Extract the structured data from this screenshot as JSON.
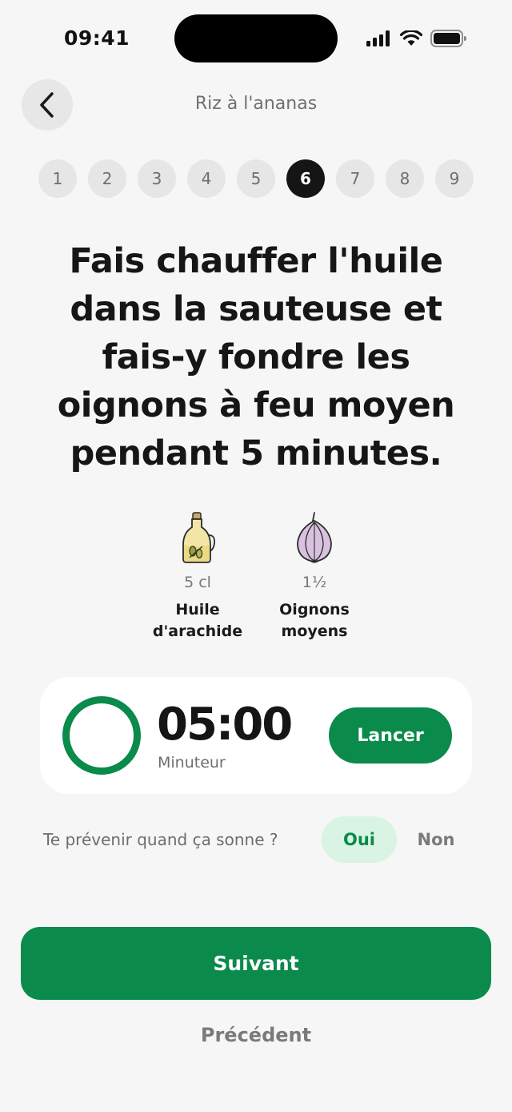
{
  "status_bar": {
    "time": "09:41"
  },
  "header": {
    "title": "Riz à l'ananas"
  },
  "steps": [
    "1",
    "2",
    "3",
    "4",
    "5",
    "6",
    "7",
    "8",
    "9"
  ],
  "current_step": "6",
  "instruction": "Fais chauffer l'huile dans la sauteuse et fais-y fondre les oignons à feu moyen pendant 5 minutes.",
  "ingredients": [
    {
      "quantity": "5 cl",
      "name": "Huile d'arachide",
      "icon": "oil-bottle-icon"
    },
    {
      "quantity": "1½",
      "name": "Oignons moyens",
      "icon": "onion-icon"
    }
  ],
  "timer": {
    "value": "05:00",
    "label": "Minuteur",
    "launch_label": "Lancer"
  },
  "notify": {
    "question": "Te prévenir quand ça sonne ?",
    "yes_label": "Oui",
    "no_label": "Non",
    "selected": "Oui"
  },
  "footer": {
    "next_label": "Suivant",
    "prev_label": "Précédent"
  },
  "colors": {
    "accent": "#0a8a4b",
    "accent_light": "#d9f4e4",
    "active_step": "#151515"
  }
}
